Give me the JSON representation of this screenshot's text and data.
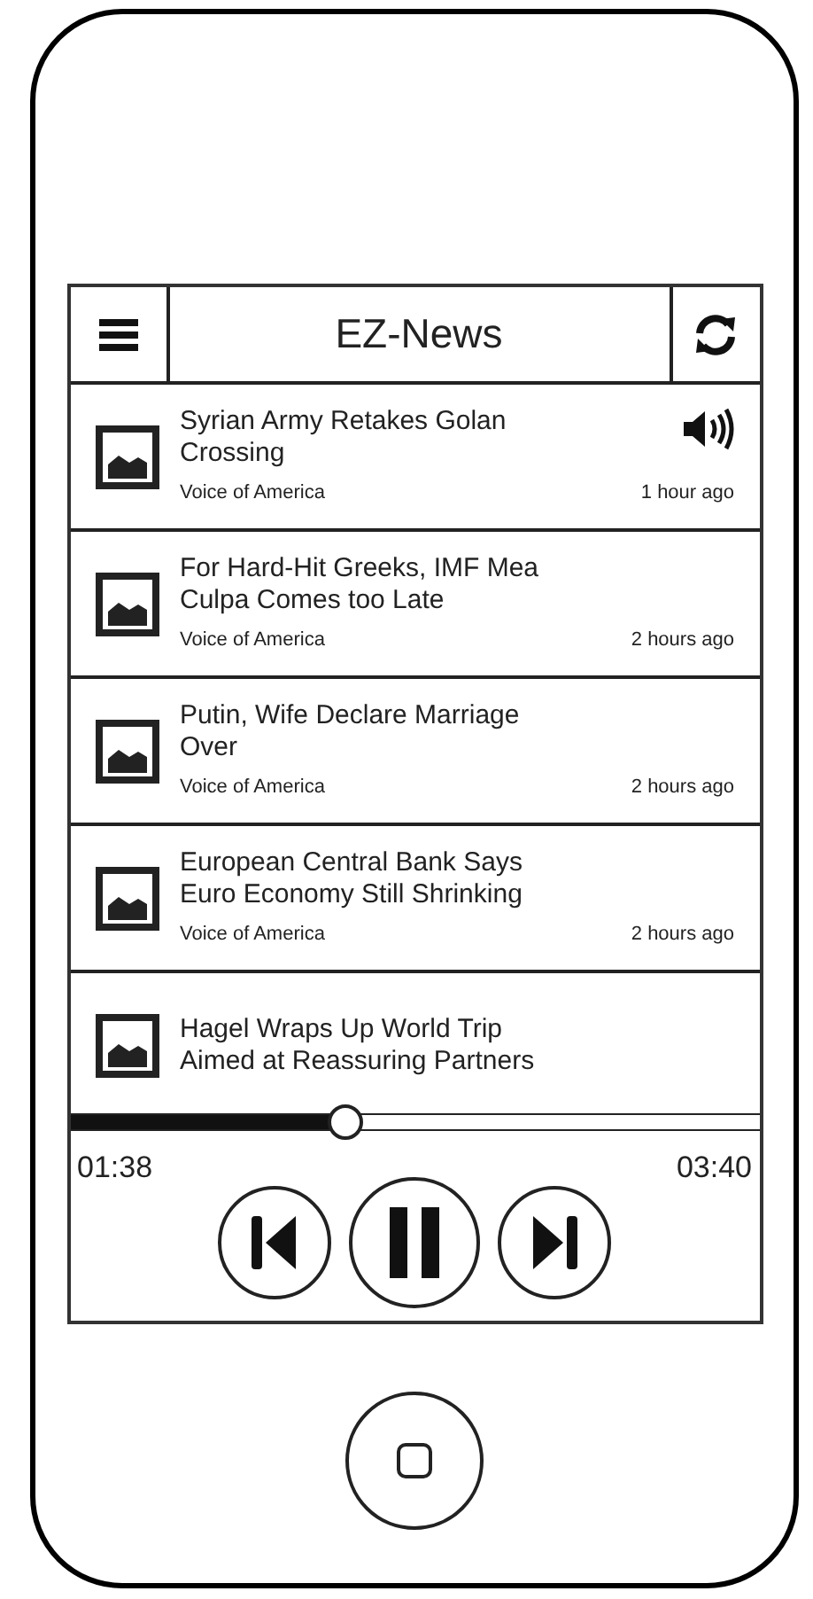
{
  "header": {
    "title": "EZ-News"
  },
  "articles": [
    {
      "title": "Syrian Army Retakes Golan Crossing",
      "source": "Voice of America",
      "time": "1 hour ago",
      "playing": true
    },
    {
      "title": "For Hard-Hit Greeks, IMF Mea Culpa Comes too Late",
      "source": "Voice of America",
      "time": "2 hours ago",
      "playing": false
    },
    {
      "title": "Putin, Wife Declare Marriage Over",
      "source": "Voice of America",
      "time": "2 hours ago",
      "playing": false
    },
    {
      "title": "European Central Bank Says Euro Economy Still Shrinking",
      "source": "Voice of America",
      "time": "2 hours ago",
      "playing": false
    },
    {
      "title": "Hagel Wraps Up World Trip Aimed at Reassuring Partners",
      "playing": false
    }
  ],
  "player": {
    "level": 0.4,
    "elapsed": "01:38",
    "duration": "03:40",
    "paused": false
  }
}
